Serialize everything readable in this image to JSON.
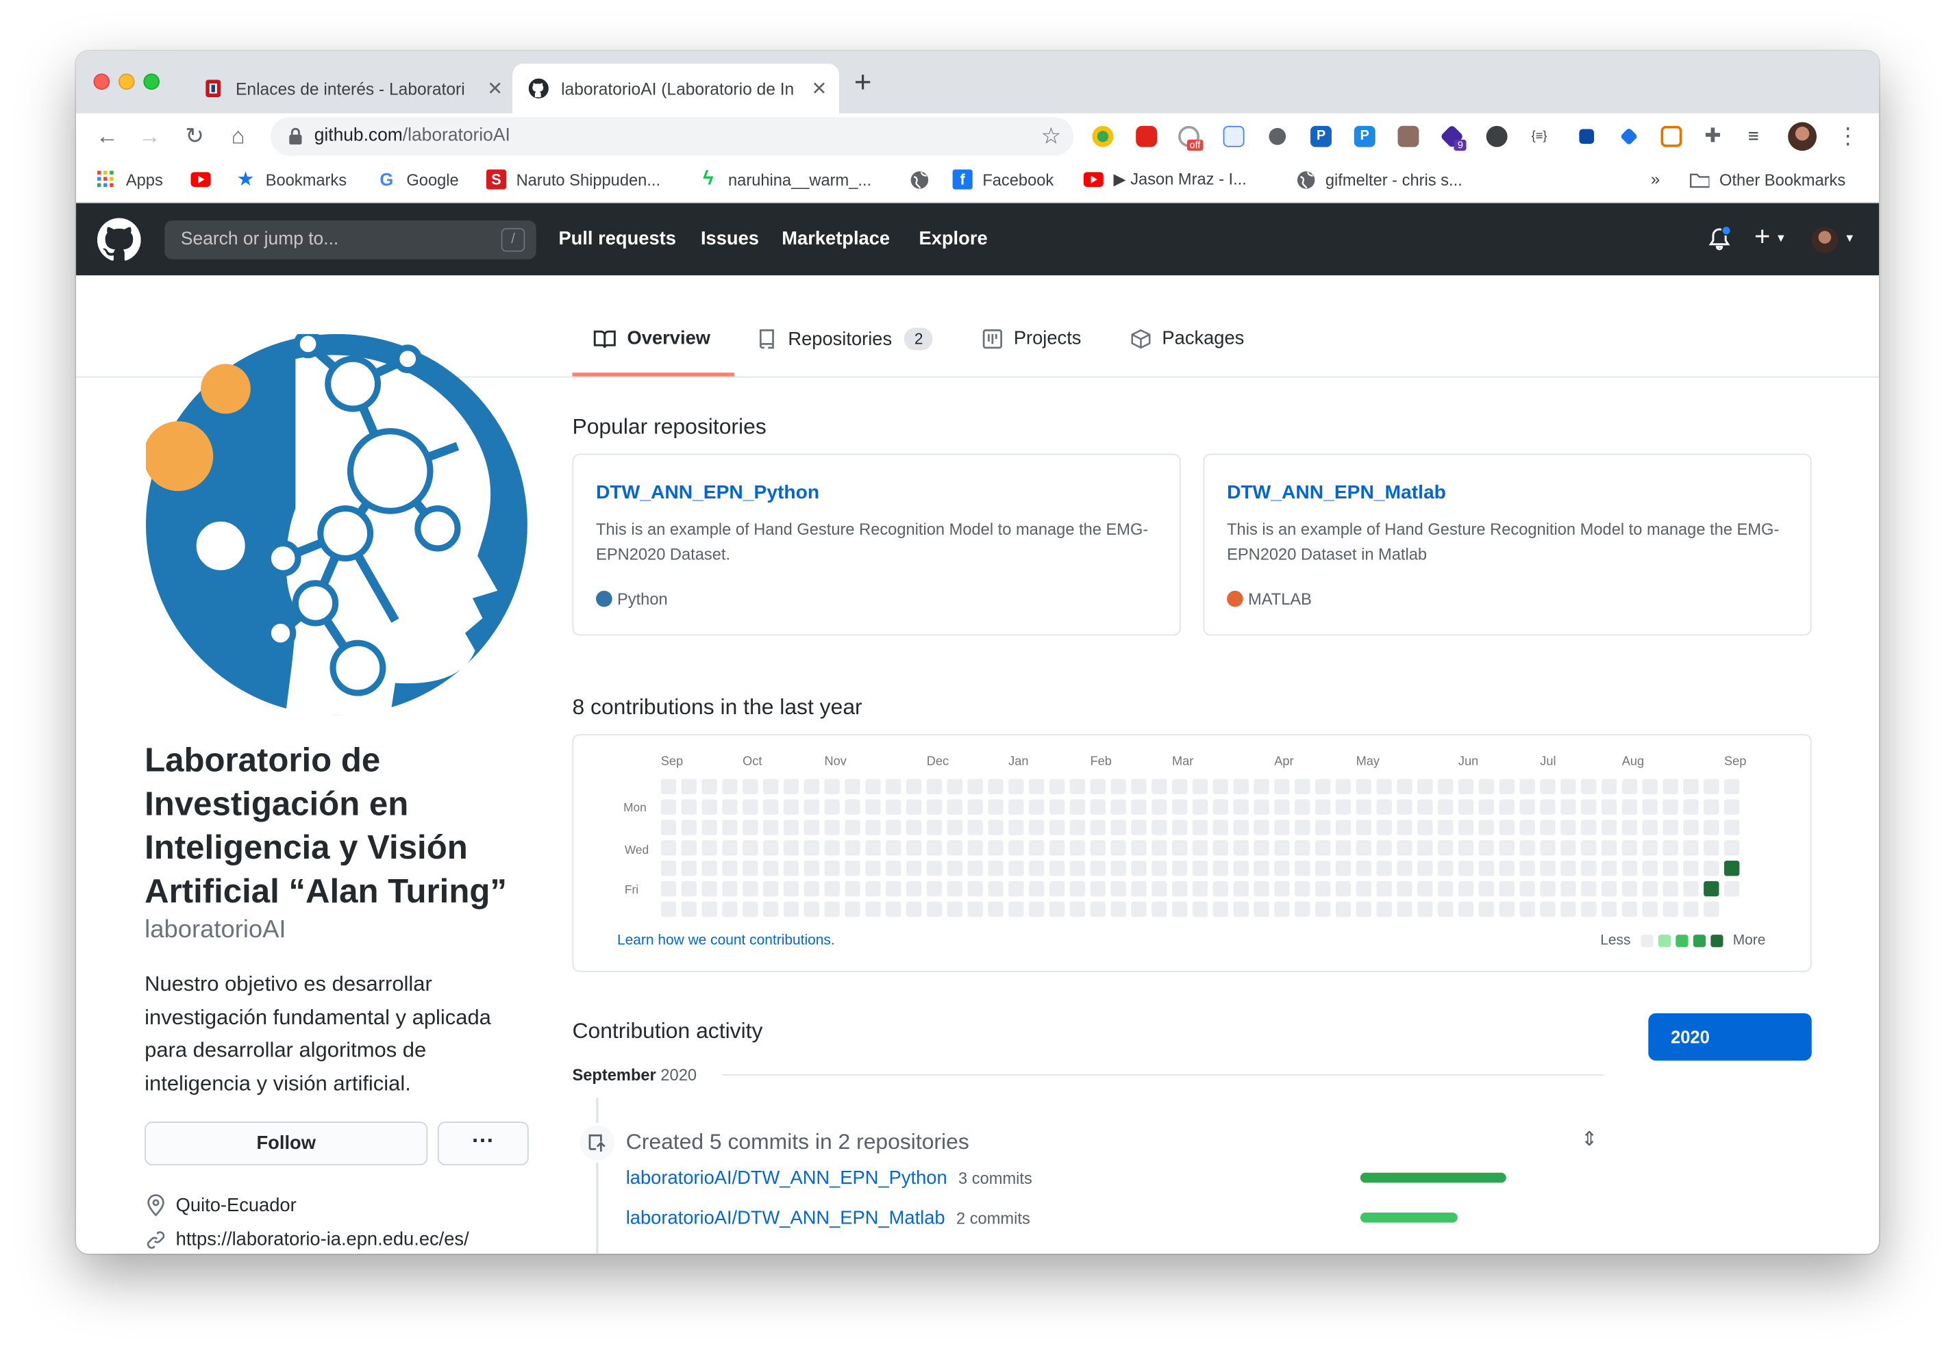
{
  "browser": {
    "tabs": [
      {
        "title": "Enlaces de interés - Laboratori",
        "active": false
      },
      {
        "title": "laboratorioAI (Laboratorio de In",
        "active": true
      }
    ],
    "new_tab": "+",
    "url_host": "github.com",
    "url_path": "/laboratorioAI",
    "bookmarks": [
      {
        "label": "Apps",
        "icon": "apps-grid-icon"
      },
      {
        "label": "",
        "icon": "youtube-icon"
      },
      {
        "label": "Bookmarks",
        "icon": "star-icon"
      },
      {
        "label": "Google",
        "icon": "google-icon"
      },
      {
        "label": "Naruto Shippuden...",
        "icon": "s-red-icon"
      },
      {
        "label": "naruhina__warm_...",
        "icon": "deviantart-icon"
      },
      {
        "label": "",
        "icon": "globe-icon"
      },
      {
        "label": "Facebook",
        "icon": "facebook-icon"
      },
      {
        "label": "▶ Jason Mraz - I...",
        "icon": "youtube-icon"
      },
      {
        "label": "gifmelter - chris s...",
        "icon": "globe-icon"
      }
    ],
    "overflow": "»",
    "other_bookmarks": "Other Bookmarks",
    "extension_badges": {
      "off": "off",
      "nine": "9"
    }
  },
  "github_header": {
    "search_placeholder": "Search or jump to...",
    "search_key": "/",
    "nav": [
      "Pull requests",
      "Issues",
      "Marketplace",
      "Explore"
    ],
    "plus": "+"
  },
  "profile_tabs": [
    {
      "label": "Overview",
      "selected": true,
      "icon": "book-icon"
    },
    {
      "label": "Repositories",
      "count": "2",
      "icon": "repo-icon"
    },
    {
      "label": "Projects",
      "icon": "project-icon"
    },
    {
      "label": "Packages",
      "icon": "package-icon"
    }
  ],
  "org": {
    "name": "Laboratorio de Investigación en Inteligencia y Visión Artificial “Alan Turing”",
    "login": "laboratorioAI",
    "bio": "Nuestro objetivo es desarrollar investigación fundamental y aplicada para desarrollar algoritmos de inteligencia y visión artificial.",
    "follow_label": "Follow",
    "more_label": "···",
    "location": "Quito-Ecuador",
    "website": "https://laboratorio-ia.epn.edu.ec/es/"
  },
  "popular": {
    "heading": "Popular repositories",
    "repos": [
      {
        "name": "DTW_ANN_EPN_Python",
        "description": "This is an example of Hand Gesture Recognition Model to manage the EMG-EPN2020 Dataset.",
        "language": "Python",
        "lang_color": "#3572A5"
      },
      {
        "name": "DTW_ANN_EPN_Matlab",
        "description": "This is an example of Hand Gesture Recognition Model to manage the EMG-EPN2020 Dataset in Matlab",
        "language": "MATLAB",
        "lang_color": "#e16737"
      }
    ]
  },
  "contributions": {
    "heading": "8 contributions in the last year",
    "months": [
      "Sep",
      "Oct",
      "Nov",
      "Dec",
      "Jan",
      "Feb",
      "Mar",
      "Apr",
      "May",
      "Jun",
      "Jul",
      "Aug",
      "Sep"
    ],
    "days": [
      "Mon",
      "Wed",
      "Fri"
    ],
    "learn": "Learn how we count contributions.",
    "less": "Less",
    "more": "More",
    "week_count": 53,
    "active_cells": [
      {
        "week": 51,
        "day": 5,
        "level": 4
      },
      {
        "week": 52,
        "day": 4,
        "level": 4
      }
    ],
    "colors": {
      "empty": "#ebedf0",
      "l1": "#9be9a8",
      "l2": "#40c463",
      "l3": "#30a14e",
      "l4": "#216e39"
    }
  },
  "activity": {
    "heading": "Contribution activity",
    "year": "2020",
    "month": "September",
    "month_year": "2020",
    "title": "Created 5 commits in 2 repositories",
    "repos": [
      {
        "name": "laboratorioAI/DTW_ANN_EPN_Python",
        "commits": "3 commits",
        "share": 1.0,
        "color": "#2ea44f"
      },
      {
        "name": "laboratorioAI/DTW_ANN_EPN_Matlab",
        "commits": "2 commits",
        "share": 0.67,
        "color": "#40c463"
      }
    ]
  }
}
